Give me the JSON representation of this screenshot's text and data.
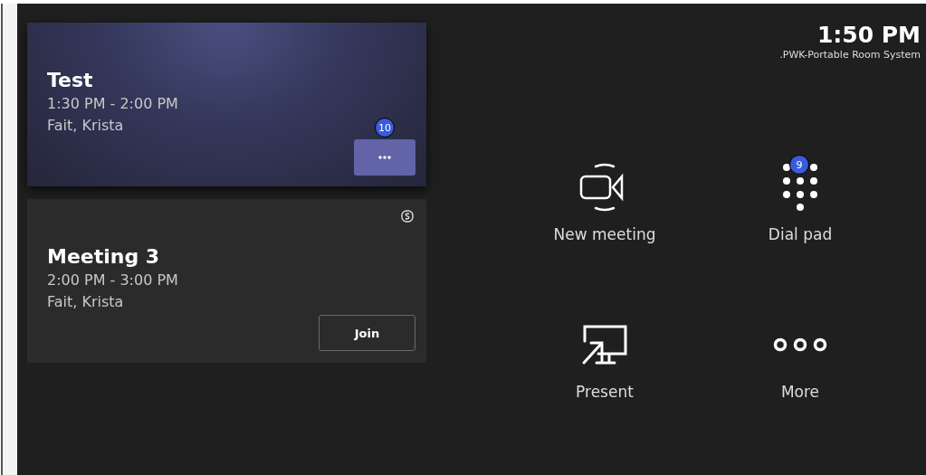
{
  "meetings": [
    {
      "title": "Test",
      "time": "1:30 PM - 2:00 PM",
      "organizer": "Fait, Krista",
      "highlighted": true,
      "skype": false,
      "action": {
        "kind": "more",
        "badge": "10"
      }
    },
    {
      "title": "Meeting 3",
      "time": "2:00 PM - 3:00 PM",
      "organizer": "Fait, Krista",
      "highlighted": false,
      "skype": true,
      "action": {
        "kind": "join",
        "label": "Join"
      }
    }
  ],
  "clock": {
    "time": "1:50 PM",
    "room": ".PWK-Portable Room System"
  },
  "actions": [
    {
      "kind": "video",
      "label": "New meeting"
    },
    {
      "kind": "present",
      "label": "Present"
    },
    {
      "kind": "dialpad",
      "label": "Dial pad",
      "badge": "9"
    },
    {
      "kind": "more",
      "label": "More"
    }
  ]
}
